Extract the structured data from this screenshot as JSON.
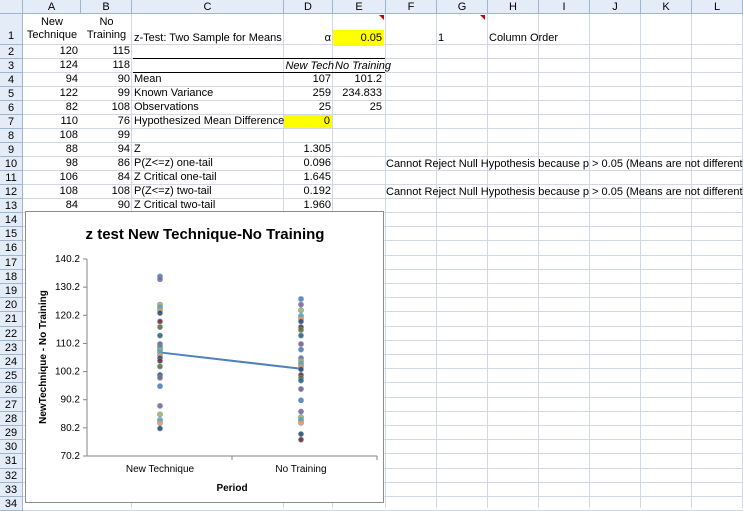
{
  "columns": [
    "A",
    "B",
    "C",
    "D",
    "E",
    "F",
    "G",
    "H",
    "I",
    "J",
    "K",
    "L"
  ],
  "rows": [
    "1",
    "2",
    "3",
    "4",
    "5",
    "6",
    "7",
    "8",
    "9",
    "10",
    "11",
    "12",
    "13",
    "14",
    "15",
    "16",
    "17",
    "18",
    "19",
    "20",
    "21",
    "22",
    "23",
    "24",
    "25",
    "26",
    "27",
    "28",
    "29",
    "30",
    "31",
    "32",
    "33",
    "34"
  ],
  "headers": {
    "a_line1": "New",
    "a_line2": "Technique",
    "b_line1": "No",
    "b_line2": "Training"
  },
  "col_a": [
    "120",
    "124",
    "94",
    "122",
    "82",
    "110",
    "108",
    "88",
    "98",
    "106",
    "108",
    "84"
  ],
  "col_b": [
    "115",
    "118",
    "90",
    "99",
    "108",
    "76",
    "99",
    "94",
    "86",
    "84",
    "108",
    "90"
  ],
  "c1_title": "z-Test: Two Sample for Means",
  "d1_alpha": "α",
  "e1_alpha_value": "0.05",
  "g1_value": "1",
  "h1_label": "Column Order",
  "d3_header": "New Tech",
  "e3_header": "No Training",
  "stats": [
    {
      "label": "Mean",
      "d": "107",
      "e": "101.2"
    },
    {
      "label": "Known Variance",
      "d": "259",
      "e": "234.833"
    },
    {
      "label": "Observations",
      "d": "25",
      "e": "25"
    },
    {
      "label": "Hypothesized Mean Difference",
      "d": "0",
      "e": ""
    },
    {
      "label": "",
      "d": "",
      "e": ""
    },
    {
      "label": "Z",
      "d": "1.305",
      "e": ""
    },
    {
      "label": "P(Z<=z) one-tail",
      "d": "0.096",
      "e": ""
    },
    {
      "label": "Z Critical one-tail",
      "d": "1.645",
      "e": ""
    },
    {
      "label": "P(Z<=z) two-tail",
      "d": "0.192",
      "e": ""
    },
    {
      "label": "Z Critical two-tail",
      "d": "1.960",
      "e": ""
    }
  ],
  "h10_note": "Cannot Reject Null Hypothesis because p > 0.05 (Means are not different)",
  "h12_note": "Cannot Reject Null Hypothesis because p > 0.05 (Means are not different)",
  "colors": {
    "yellow": "#ffff00",
    "header_bg": "#e4ecf7",
    "grid": "#d0d7e5",
    "line": "#4f81bd"
  },
  "chart_data": {
    "type": "scatter",
    "title": "z test New Technique-No Training",
    "xlabel": "Period",
    "ylabel": "NewTechnique - No Training",
    "categories": [
      "New Technique",
      "No Training"
    ],
    "yticks": [
      "140.2",
      "130.2",
      "120.2",
      "110.2",
      "100.2",
      "90.2",
      "80.2",
      "70.2"
    ],
    "ylim": [
      70.2,
      140.2
    ],
    "series": [
      {
        "values": [
          134,
          133,
          124,
          123,
          122,
          121,
          118,
          116,
          113,
          110,
          109,
          108,
          108,
          107,
          106,
          105,
          104,
          102,
          99,
          98,
          95,
          88,
          85,
          83,
          82,
          80
        ]
      },
      {
        "values": [
          126,
          124,
          122,
          120,
          119,
          118,
          116,
          115,
          113,
          110,
          108,
          105,
          104,
          103,
          102,
          101,
          99,
          98,
          97,
          94,
          90,
          86,
          84,
          83,
          82,
          78,
          76
        ]
      }
    ],
    "mean_line": [
      107,
      101.2
    ]
  }
}
